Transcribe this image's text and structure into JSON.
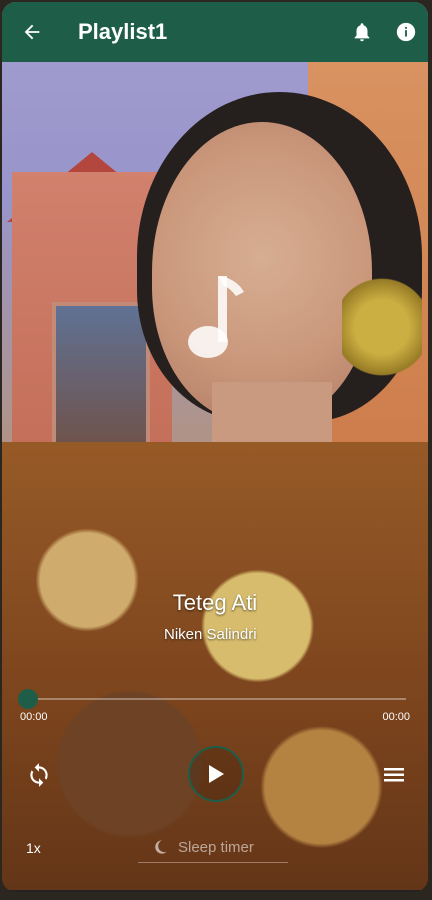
{
  "header": {
    "title": "Playlist1"
  },
  "track": {
    "title": "Teteg Ati",
    "artist": "Niken Salindri"
  },
  "player": {
    "position": "00:00",
    "duration": "00:00",
    "progress": 0
  },
  "controls": {
    "speed": "1x",
    "sleep_timer": "Sleep timer"
  },
  "icons": {
    "back": "arrow-left-icon",
    "bell": "bell-icon",
    "info": "info-icon",
    "note": "music-note-icon",
    "repeat": "repeat-icon",
    "play": "play-icon",
    "queue": "queue-icon",
    "moon": "moon-icon"
  },
  "colors": {
    "accent": "#1e5e49"
  }
}
